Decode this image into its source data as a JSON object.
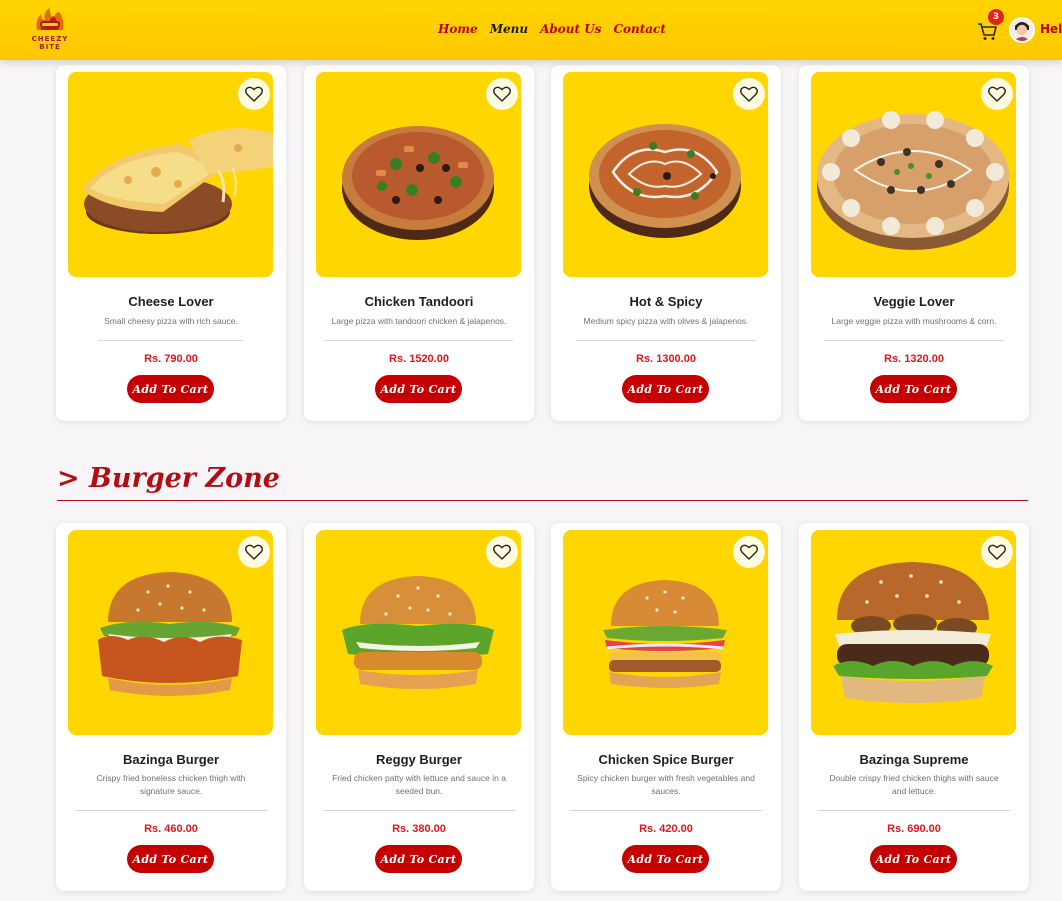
{
  "header": {
    "logo_text": "CHEEZY BITE",
    "nav": [
      "Home",
      "Menu",
      "About Us",
      "Contact"
    ],
    "active_nav": "Menu",
    "cart_count": "3",
    "greeting": "Hell"
  },
  "colors": {
    "header_bg": "#ffd400",
    "accent_red": "#c40000",
    "price_red": "#e4151a",
    "image_bg": "#ffd600"
  },
  "pizza_cards": [
    {
      "name": "Cheese Lover",
      "desc": "Small cheesy pizza with rich sauce.",
      "price": "Rs. 790.00",
      "button": "Add To Cart",
      "icon": "cheese-pizza-slice-icon"
    },
    {
      "name": "Chicken Tandoori",
      "desc": "Large pizza with tandoori chicken & jalapenos.",
      "price": "Rs. 1520.00",
      "button": "Add To Cart",
      "icon": "tandoori-pizza-icon"
    },
    {
      "name": "Hot & Spicy",
      "desc": "Medium spicy pizza with olives & jalapenos.",
      "price": "Rs. 1300.00",
      "button": "Add To Cart",
      "icon": "spicy-pizza-icon"
    },
    {
      "name": "Veggie Lover",
      "desc": "Large veggie pizza with mushrooms & corn.",
      "price": "Rs. 1320.00",
      "button": "Add To Cart",
      "icon": "veggie-pizza-icon"
    }
  ],
  "burger_section": {
    "title": "> Burger Zone"
  },
  "burger_cards": [
    {
      "name": "Bazinga Burger",
      "desc": "Crispy fried boneless chicken thigh with signature sauce.",
      "price": "Rs. 460.00",
      "button": "Add To Cart",
      "icon": "crispy-chicken-burger-icon"
    },
    {
      "name": "Reggy Burger",
      "desc": "Fried chicken patty with lettuce and sauce in a seeded bun.",
      "price": "Rs. 380.00",
      "button": "Add To Cart",
      "icon": "chicken-patty-burger-icon"
    },
    {
      "name": "Chicken Spice Burger",
      "desc": "Spicy chicken burger with fresh vegetables and sauces.",
      "price": "Rs. 420.00",
      "button": "Add To Cart",
      "icon": "spice-burger-icon"
    },
    {
      "name": "Bazinga Supreme",
      "desc": "Double crispy fried chicken thighs with sauce and lettuce.",
      "price": "Rs. 690.00",
      "button": "Add To Cart",
      "icon": "supreme-burger-icon"
    }
  ]
}
